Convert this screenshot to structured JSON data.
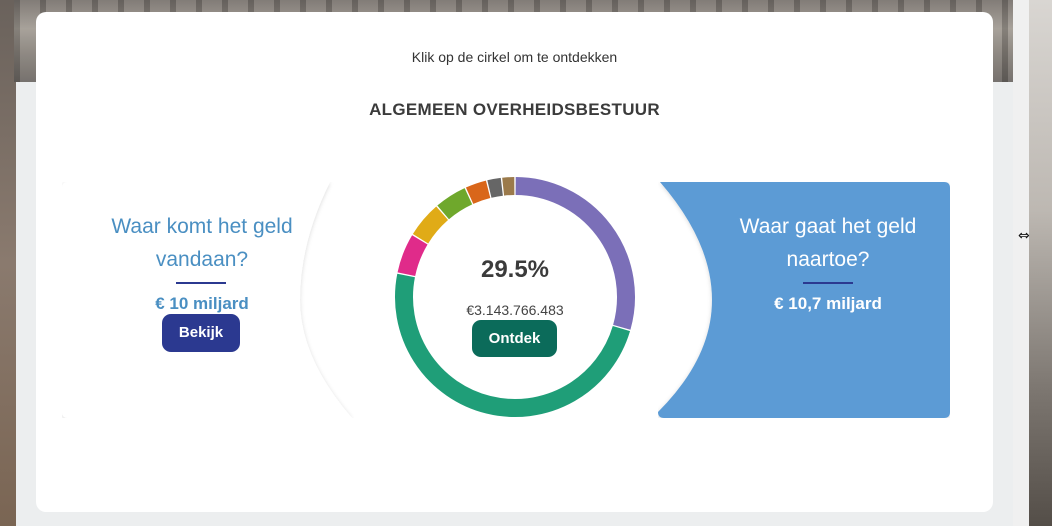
{
  "hint": "Klik op de cirkel om te ontdekken",
  "title": "ALGEMEEN OVERHEIDSBESTUUR",
  "income": {
    "heading_line1": "Waar komt het geld",
    "heading_line2": "vandaan?",
    "amount": "€ 10 miljard",
    "button_label": "Bekijk"
  },
  "spending": {
    "heading_line1": "Waar gaat het geld",
    "heading_line2": "naartoe?",
    "amount": "€ 10,7 miljard"
  },
  "donut": {
    "percent": "29.5%",
    "amount": "€3.143.766.483",
    "button_label": "Ontdek",
    "segments": [
      {
        "color": "#7b6fb8",
        "share": 0.295
      },
      {
        "color": "#1f9e78",
        "share": 0.487
      },
      {
        "color": "#e02b8a",
        "share": 0.055
      },
      {
        "color": "#e0ab17",
        "share": 0.05
      },
      {
        "color": "#6fa82c",
        "share": 0.045
      },
      {
        "color": "#d9661a",
        "share": 0.03
      },
      {
        "color": "#666666",
        "share": 0.02
      },
      {
        "color": "#9b7a4b",
        "share": 0.018
      }
    ]
  },
  "colors": {
    "accent_blue": "#4a8fc2",
    "navy": "#2b3990",
    "teal_button": "#0b6b5a",
    "spending_panel": "#5b9bd5"
  }
}
